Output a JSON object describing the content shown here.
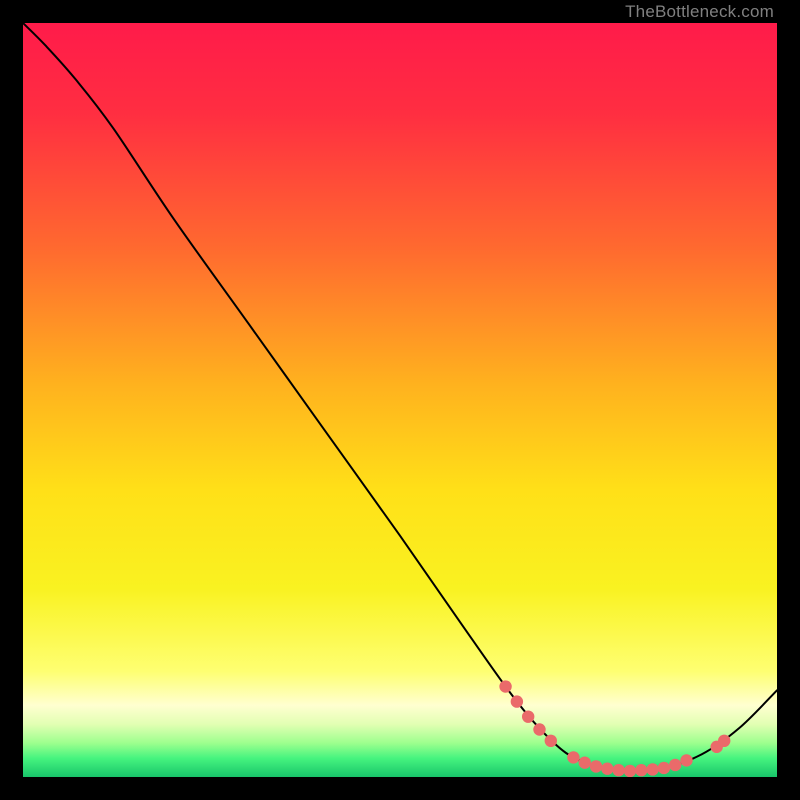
{
  "attribution": "TheBottleneck.com",
  "chart_data": {
    "type": "line",
    "title": "",
    "xlabel": "",
    "ylabel": "",
    "xlim": [
      0,
      100
    ],
    "ylim": [
      0,
      100
    ],
    "gradient_stops": [
      {
        "offset": 0.0,
        "color": "#ff1b4a"
      },
      {
        "offset": 0.12,
        "color": "#ff2e41"
      },
      {
        "offset": 0.3,
        "color": "#ff6a2f"
      },
      {
        "offset": 0.48,
        "color": "#ffb21e"
      },
      {
        "offset": 0.62,
        "color": "#ffe018"
      },
      {
        "offset": 0.75,
        "color": "#f9f221"
      },
      {
        "offset": 0.86,
        "color": "#feff72"
      },
      {
        "offset": 0.905,
        "color": "#ffffd0"
      },
      {
        "offset": 0.93,
        "color": "#e2ffb3"
      },
      {
        "offset": 0.955,
        "color": "#9dff8e"
      },
      {
        "offset": 0.975,
        "color": "#46f47f"
      },
      {
        "offset": 1.0,
        "color": "#18c56a"
      }
    ],
    "series": [
      {
        "name": "curve",
        "color": "#000000",
        "stroke_width": 2,
        "points": [
          {
            "x": 0.0,
            "y": 100.0
          },
          {
            "x": 3.0,
            "y": 97.0
          },
          {
            "x": 7.0,
            "y": 92.5
          },
          {
            "x": 12.0,
            "y": 86.0
          },
          {
            "x": 20.0,
            "y": 74.0
          },
          {
            "x": 30.0,
            "y": 60.0
          },
          {
            "x": 40.0,
            "y": 46.0
          },
          {
            "x": 50.0,
            "y": 32.0
          },
          {
            "x": 58.0,
            "y": 20.5
          },
          {
            "x": 64.0,
            "y": 12.0
          },
          {
            "x": 68.0,
            "y": 7.0
          },
          {
            "x": 72.0,
            "y": 3.2
          },
          {
            "x": 76.0,
            "y": 1.4
          },
          {
            "x": 80.0,
            "y": 0.8
          },
          {
            "x": 85.0,
            "y": 1.2
          },
          {
            "x": 90.0,
            "y": 3.0
          },
          {
            "x": 95.0,
            "y": 6.5
          },
          {
            "x": 100.0,
            "y": 11.5
          }
        ]
      }
    ],
    "markers": {
      "color": "#ea6a6a",
      "points": [
        {
          "x": 64.0,
          "y": 12.0
        },
        {
          "x": 65.5,
          "y": 10.0
        },
        {
          "x": 67.0,
          "y": 8.0
        },
        {
          "x": 68.5,
          "y": 6.3
        },
        {
          "x": 70.0,
          "y": 4.8
        },
        {
          "x": 73.0,
          "y": 2.6
        },
        {
          "x": 74.5,
          "y": 1.9
        },
        {
          "x": 76.0,
          "y": 1.4
        },
        {
          "x": 77.5,
          "y": 1.1
        },
        {
          "x": 79.0,
          "y": 0.9
        },
        {
          "x": 80.5,
          "y": 0.8
        },
        {
          "x": 82.0,
          "y": 0.9
        },
        {
          "x": 83.5,
          "y": 1.0
        },
        {
          "x": 85.0,
          "y": 1.2
        },
        {
          "x": 86.5,
          "y": 1.6
        },
        {
          "x": 88.0,
          "y": 2.2
        },
        {
          "x": 92.0,
          "y": 4.0
        },
        {
          "x": 93.0,
          "y": 4.8
        }
      ]
    }
  }
}
